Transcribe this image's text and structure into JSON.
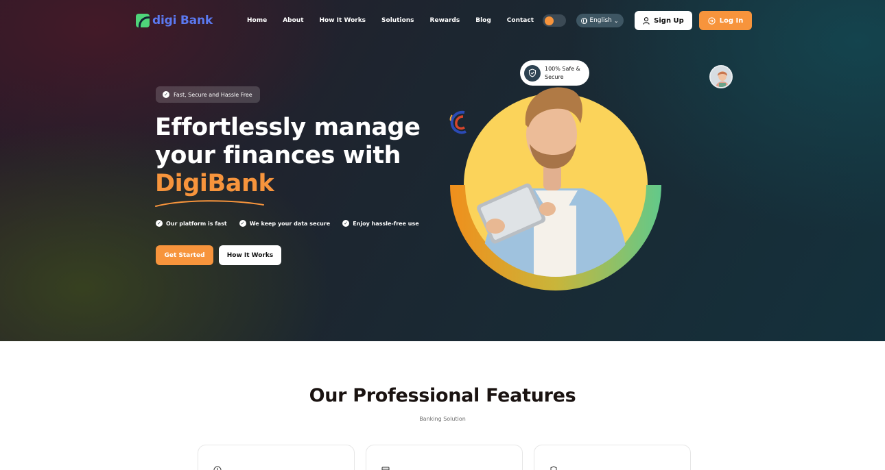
{
  "brand": {
    "name": "digi Bank"
  },
  "nav": {
    "items": [
      "Home",
      "About",
      "How It Works",
      "Solutions",
      "Rewards",
      "Blog",
      "Contact"
    ],
    "language": "English",
    "signup_label": "Sign Up",
    "login_label": "Log In"
  },
  "hero": {
    "badge": "Fast, Secure and Hassle Free",
    "headline_line1": "Effortlessly manage",
    "headline_line2": "your finances with",
    "headline_accent": "DigiBank",
    "bullets": [
      "Our platform is fast",
      "We keep your data secure",
      "Enjoy hassle-free use"
    ],
    "cta_primary": "Get Started",
    "cta_secondary": "How It Works",
    "safe_badge": "100% Safe & Secure"
  },
  "features": {
    "title": "Our Professional Features",
    "subtitle": "Banking Solution",
    "cards": [
      {
        "icon": "clock-icon"
      },
      {
        "icon": "card-icon"
      },
      {
        "icon": "shield-icon"
      }
    ]
  },
  "colors": {
    "accent": "#f7943c",
    "brand_blue": "#5b79f0",
    "brand_green": "#4fd47a",
    "circle_yellow": "#fbd35a"
  }
}
